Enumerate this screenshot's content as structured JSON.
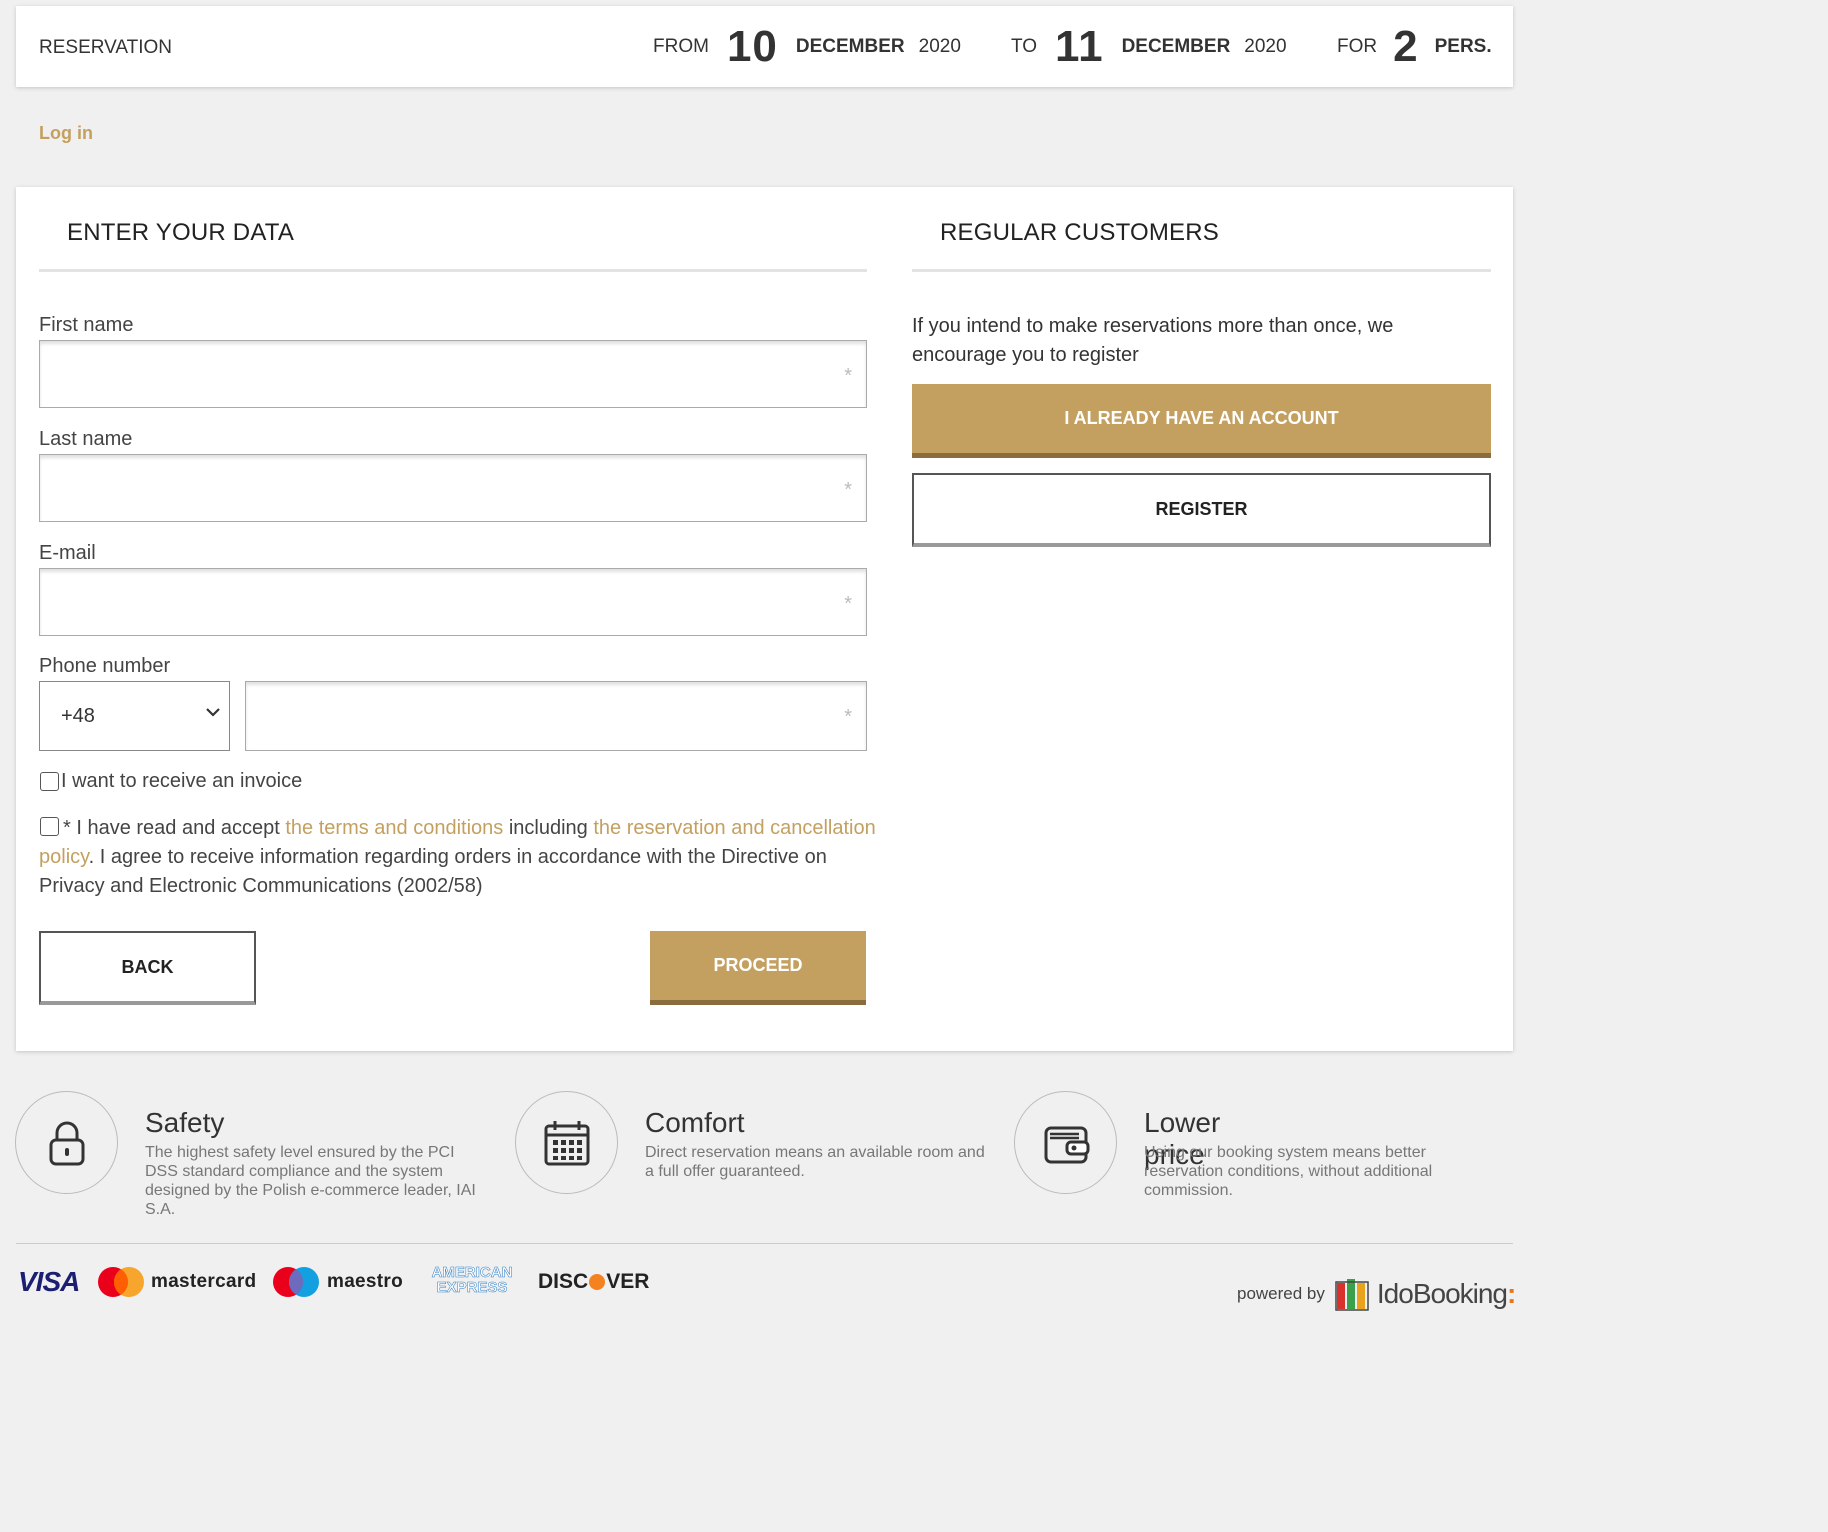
{
  "reservation": {
    "label": "RESERVATION",
    "from_word": "FROM",
    "from_day": "10",
    "from_month": "DECEMBER",
    "from_year": "2020",
    "to_word": "TO",
    "to_day": "11",
    "to_month": "DECEMBER",
    "to_year": "2020",
    "for_word": "FOR",
    "persons": "2",
    "pers_label": "PERS."
  },
  "login_link": "Log in",
  "form": {
    "title": "ENTER YOUR DATA",
    "first_name_label": "First name",
    "last_name_label": "Last name",
    "email_label": "E-mail",
    "phone_label": "Phone number",
    "phone_prefix": "+48",
    "required_mark": "*",
    "invoice_label": "I want to receive an invoice",
    "terms_prefix": "* I have read and accept ",
    "terms_link": "the terms and conditions",
    "terms_mid": " including ",
    "policy_link": "the reservation and cancellation policy",
    "terms_suffix": ". I agree to receive information regarding orders in accordance with the Directive on Privacy and Electronic Communications (2002/58)",
    "back_button": "BACK",
    "proceed_button": "PROCEED"
  },
  "regular": {
    "title": "REGULAR CUSTOMERS",
    "text": "If you intend to make reservations more than once, we encourage you to register",
    "account_button": "I ALREADY HAVE AN ACCOUNT",
    "register_button": "REGISTER"
  },
  "features": [
    {
      "icon": "lock-icon",
      "title": "Safety",
      "text": "The highest safety level ensured by the PCI DSS standard compliance and the system designed by the Polish e-commerce leader, IAI S.A."
    },
    {
      "icon": "calendar-icon",
      "title": "Comfort",
      "text": "Direct reservation means an available room and a full offer guaranteed."
    },
    {
      "icon": "wallet-icon",
      "title": "Lower price",
      "text": "Using our booking system means better reservation conditions, without additional commission."
    }
  ],
  "payments": {
    "visa": "VISA",
    "mastercard": "mastercard",
    "maestro": "maestro",
    "amex_line1": "AMERICAN",
    "amex_line2": "EXPRESS",
    "discover_a": "DISC",
    "discover_b": "VER"
  },
  "footer": {
    "powered_by": "powered by",
    "brand": "IdoBooking"
  },
  "colors": {
    "accent": "#c4a060",
    "accent_dark": "#8a6c3d",
    "background": "#f0f0f0"
  }
}
